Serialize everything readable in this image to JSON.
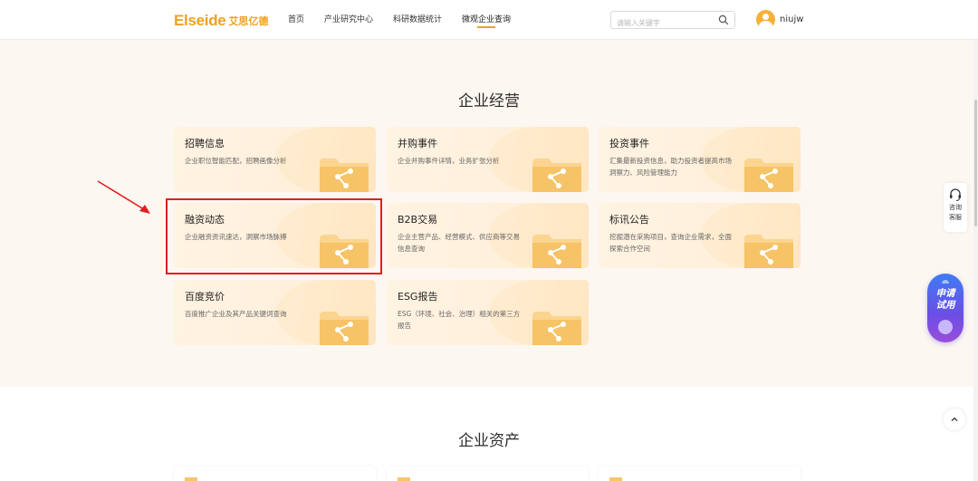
{
  "header": {
    "logo_en": "Elseide",
    "logo_cn": "艾思亿德",
    "nav": [
      {
        "label": "首页",
        "active": false
      },
      {
        "label": "产业研究中心",
        "active": false
      },
      {
        "label": "科研数据统计",
        "active": false
      },
      {
        "label": "微观企业查询",
        "active": true
      }
    ],
    "search_placeholder": "请输入关键字",
    "username": "niujw"
  },
  "sections": {
    "operations_title": "企业经营",
    "assets_title": "企业资产"
  },
  "cards": [
    {
      "title": "招聘信息",
      "desc": "企业职位智能匹配，招聘画像分析"
    },
    {
      "title": "并购事件",
      "desc": "企业并购事件详情，业务扩张分析"
    },
    {
      "title": "投资事件",
      "desc": "汇集最新投资信息，助力投资者提高市场洞察力、风险管理能力"
    },
    {
      "title": "融资动态",
      "desc": "企业融资资讯速达，洞察市场脉搏"
    },
    {
      "title": "B2B交易",
      "desc": "企业主营产品、经营模式、供应商等交易信息查询"
    },
    {
      "title": "标讯公告",
      "desc": "挖掘潜在采购项目，查询企业需求，全面探索合作空间"
    },
    {
      "title": "百度竞价",
      "desc": "百度推广企业及其产品关键词查询"
    },
    {
      "title": "ESG报告",
      "desc": "ESG（环境、社会、治理）相关的第三方报告"
    }
  ],
  "widgets": {
    "consult_line1": "咨询",
    "consult_line2": "客服",
    "apply_line1": "申请",
    "apply_line2": "试用"
  },
  "colors": {
    "accent": "#f0a020",
    "highlight": "#e0201f",
    "apply_gradient_start": "#3f7cf5",
    "apply_gradient_end": "#9a4ed9"
  }
}
